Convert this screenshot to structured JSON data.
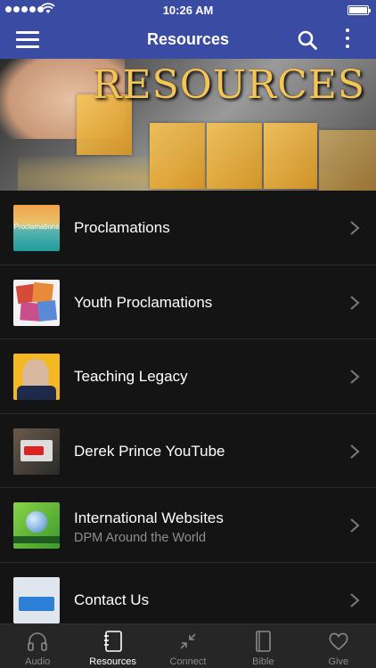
{
  "status": {
    "time": "10:26 AM"
  },
  "header": {
    "title": "Resources"
  },
  "banner": {
    "text": "RESOURCES"
  },
  "items": [
    {
      "label": "Proclamations",
      "thumb_text": "Proclamations"
    },
    {
      "label": "Youth Proclamations"
    },
    {
      "label": "Teaching Legacy"
    },
    {
      "label": "Derek Prince YouTube"
    },
    {
      "label": "International Websites",
      "subtitle": "DPM Around the World"
    },
    {
      "label": "Contact Us"
    }
  ],
  "tabs": [
    {
      "label": "Audio",
      "icon": "headphones-icon"
    },
    {
      "label": "Resources",
      "icon": "notebook-icon",
      "active": true
    },
    {
      "label": "Connect",
      "icon": "connect-arrows-icon"
    },
    {
      "label": "Bible",
      "icon": "book-icon"
    },
    {
      "label": "Give",
      "icon": "heart-icon"
    }
  ],
  "colors": {
    "nav": "#3a4ba3",
    "background": "#141414",
    "tabbar": "#262626"
  }
}
